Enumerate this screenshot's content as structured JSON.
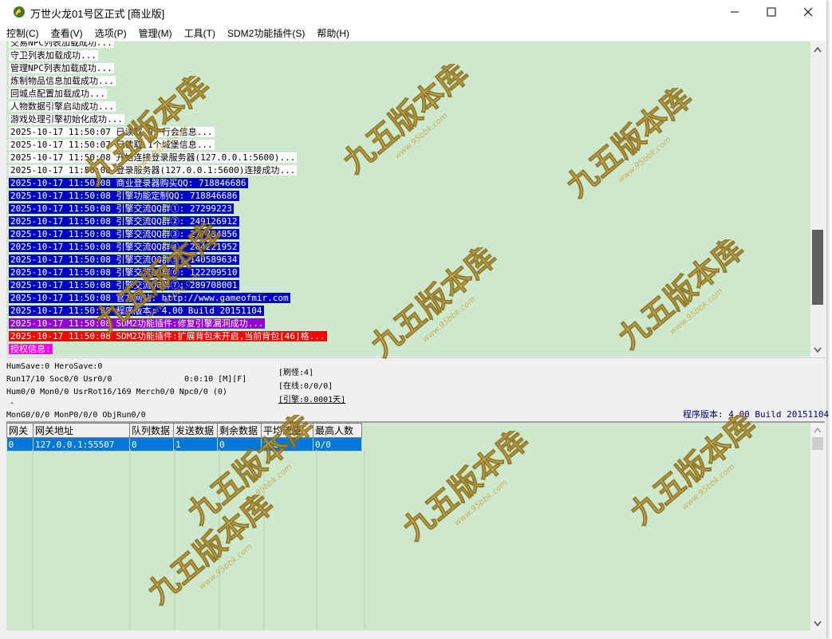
{
  "window": {
    "title": "万世火龙01号区正式 [商业版]",
    "buttons": {
      "minimize": "—",
      "maximize": "☐",
      "close": "✕"
    }
  },
  "menu": [
    "控制(C)",
    "查看(V)",
    "选项(P)",
    "管理(M)",
    "工具(T)",
    "SDM2功能插件(S)",
    "帮助(H)"
  ],
  "log": [
    {
      "text": "交易NPC列表加载成功...",
      "style": "plain"
    },
    {
      "text": "守卫列表加载成功...",
      "style": "plain"
    },
    {
      "text": "管理NPC列表加载成功...",
      "style": "plain"
    },
    {
      "text": "炼制物品信息加载成功...",
      "style": "plain"
    },
    {
      "text": "回城点配置加载成功...",
      "style": "plain"
    },
    {
      "text": "人物数据引擎启动成功...",
      "style": "plain"
    },
    {
      "text": "游戏处理引擎初始化成功...",
      "style": "plain"
    },
    {
      "text": "2025-10-17 11:50:07 已读取 0个行会信息...",
      "style": "plain"
    },
    {
      "text": "2025-10-17 11:50:07 已读取 1个城堡信息...",
      "style": "plain"
    },
    {
      "text": "2025-10-17 11:50:08 开始连接登录服务器(127.0.0.1:5600)...",
      "style": "plain"
    },
    {
      "text": "2025-10-17 11:50:08 登录服务器(127.0.0.1:5600)连接成功...",
      "style": "plain"
    },
    {
      "text": "2025-10-17 11:50:08 商业登录器购买QQ: 718846686",
      "style": "blue"
    },
    {
      "text": "2025-10-17 11:50:08 引擎功能定制QQ: 718846686",
      "style": "blue"
    },
    {
      "text": "2025-10-17 11:50:08 引擎交流QQ群①: 27299223",
      "style": "blue"
    },
    {
      "text": "2025-10-17 11:50:08 引擎交流QQ群②: 249126912",
      "style": "blue"
    },
    {
      "text": "2025-10-17 11:50:08 引擎交流QQ群③: 277734856",
      "style": "blue"
    },
    {
      "text": "2025-10-17 11:50:08 引擎交流QQ群④: 264221952",
      "style": "blue"
    },
    {
      "text": "2025-10-17 11:50:08 引擎交流QQ群⑤: 140589634",
      "style": "blue"
    },
    {
      "text": "2025-10-17 11:50:08 引擎交流QQ群⑥: 122209510",
      "style": "blue"
    },
    {
      "text": "2025-10-17 11:50:08 引擎交流QQ群⑦: 289708001",
      "style": "blue"
    },
    {
      "text": "2025-10-17 11:50:08 官方网站: http://www.gameofmir.com",
      "style": "blue"
    },
    {
      "text": "2025-10-17 11:50:08 程序版本: 4.00 Build 20151104",
      "style": "blue"
    },
    {
      "text": "2025-10-17 11:50:08 SDM2功能插件:修复引擎漏洞成功...",
      "style": "purple"
    },
    {
      "text": "2025-10-17 11:50:08 SDM2功能插件:扩展背包未开启,当前背包[46]格...",
      "style": "red"
    },
    {
      "text": "授权信息:",
      "style": "magenta"
    }
  ],
  "status": {
    "line1": "HumSave:0 HeroSave:0",
    "line2": "Run17/10 Soc0/0 Usr0/0",
    "line3": "Hum0/0 Mon0/0 UsrRot16/169 Merch0/0 Npc0/0 (0)",
    "line4": "-",
    "line5": "MonG0/0/0 MonP0/0/0 ObjRun0/0",
    "timer": "0:0:10 [M][F]",
    "refresh": "[刷怪:4]",
    "online": "[在线:0/0/0]",
    "engine": "[引擎:0.0001天]",
    "version": "程序版本: 4.00 Build 20151104"
  },
  "gate_table": {
    "columns": [
      "网关",
      "网关地址",
      "队列数据",
      "发送数据",
      "剩余数据",
      "平均流量",
      "最高人数"
    ],
    "rows": [
      [
        "0",
        "127.0.0.1:55507",
        "0",
        "1",
        "0",
        "20b",
        "0/0"
      ]
    ]
  },
  "watermark": {
    "text": "九五版本库",
    "url": "www.95bbk.com",
    "color": "#e0c060"
  },
  "colors": {
    "pane_bg": "#cde8cd",
    "log_blue": "#0000cc",
    "log_purple": "#9400d3",
    "log_red": "#ff0000",
    "log_magenta": "#ff00ff",
    "selection": "#0078d7"
  }
}
